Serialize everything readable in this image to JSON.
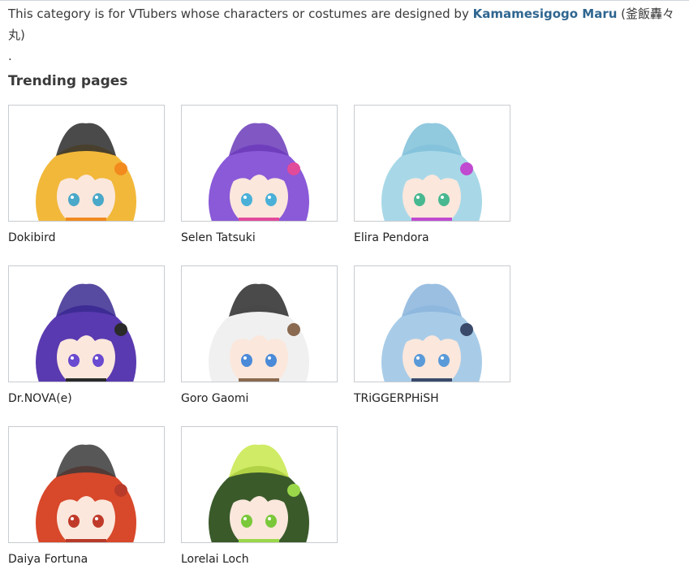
{
  "description": {
    "before": "This category is for VTubers whose characters or costumes are designed by ",
    "link": "Kamamesigogo Maru",
    "after": " (釜飯轟々丸)",
    "trailing": "."
  },
  "section": {
    "heading": "Trending pages"
  },
  "cards": [
    {
      "name": "Dokibird",
      "hair": "#f2b83a",
      "hat": "#2a2a2a",
      "accent": "#f28a1e",
      "eyes": "#4aa8c8"
    },
    {
      "name": "Selen Tatsuki",
      "hair": "#8a5ad8",
      "hat": "#6a3ab8",
      "accent": "#e24a9a",
      "eyes": "#4ab0d8"
    },
    {
      "name": "Elira Pendora",
      "hair": "#a8d8e8",
      "hat": "#7ec0d8",
      "accent": "#c04ad0",
      "eyes": "#48b890"
    },
    {
      "name": "Dr.NOVA(e)",
      "hair": "#5a3ab0",
      "hat": "#3a2a90",
      "accent": "#2a2a2a",
      "eyes": "#6a4ad0"
    },
    {
      "name": "Goro Gaomi",
      "hair": "#f0f0f0",
      "hat": "#2a2a2a",
      "accent": "#8a6a50",
      "eyes": "#4a8ad8"
    },
    {
      "name": "TRiGGERPHiSH",
      "hair": "#a8cce8",
      "hat": "#8ab4dc",
      "accent": "#3a4a6a",
      "eyes": "#5a9ad8"
    },
    {
      "name": "Daiya Fortuna",
      "hair": "#d8482a",
      "hat": "#3a3a3a",
      "accent": "#b83a2a",
      "eyes": "#c03a2a"
    },
    {
      "name": "Lorelai Loch",
      "hair": "#3a5a2a",
      "hat": "#c8e84a",
      "accent": "#9ad84a",
      "eyes": "#7ac83a"
    }
  ]
}
